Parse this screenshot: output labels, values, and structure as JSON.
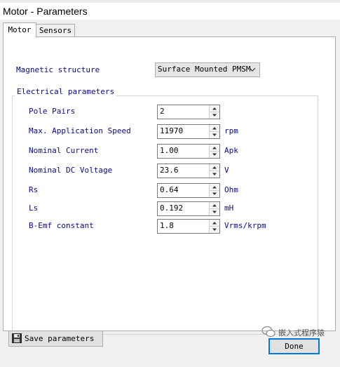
{
  "window": {
    "title": "Motor - Parameters"
  },
  "tabs": [
    {
      "label": "Motor",
      "active": true
    },
    {
      "label": "Sensors",
      "active": false
    }
  ],
  "magnetic": {
    "label": "Magnetic structure",
    "value": "Surface Mounted PMSM"
  },
  "group": {
    "title": "Electrical parameters"
  },
  "params": [
    {
      "label": "Pole Pairs",
      "value": "2",
      "unit": ""
    },
    {
      "label": "Max. Application Speed",
      "value": "11970",
      "unit": "rpm"
    },
    {
      "label": "Nominal Current",
      "value": "1.00",
      "unit": "Apk"
    },
    {
      "label": "Nominal DC Voltage",
      "value": "23.6",
      "unit": "V"
    },
    {
      "label": "Rs",
      "value": "0.64",
      "unit": "Ohm"
    },
    {
      "label": "Ls",
      "value": "0.192",
      "unit": "mH"
    },
    {
      "label": "B-Emf constant",
      "value": "1.8",
      "unit": "Vrms/krpm"
    }
  ],
  "buttons": {
    "save": "Save parameters",
    "done": "Done"
  },
  "icons": {
    "save": "floppy-disk-icon",
    "combo": "chevron-down-icon",
    "spin": "spin-arrows-icon"
  },
  "colors": {
    "label_text": "#0a0a80",
    "done_border": "#0078d7",
    "panel_bg": "#ffffff",
    "client_bg": "#f0f0f0"
  }
}
